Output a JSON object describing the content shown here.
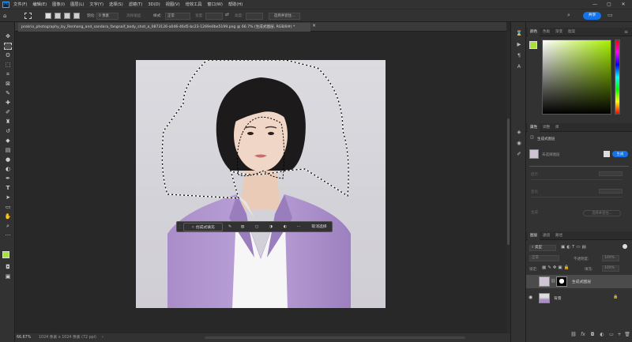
{
  "app": {
    "logo": "Ps"
  },
  "menu": [
    "文件(F)",
    "编辑(E)",
    "图像(I)",
    "图层(L)",
    "文字(Y)",
    "选择(S)",
    "滤镜(T)",
    "3D(D)",
    "视图(V)",
    "增效工具",
    "窗口(W)",
    "帮助(H)"
  ],
  "window_controls": {
    "minimize": "—",
    "maximize": "▢",
    "close": "✕"
  },
  "options": {
    "feather_label": "羽化:",
    "feather_value": "0 像素",
    "antialias_label": "消除锯齿",
    "style_label": "样式:",
    "style_value": "正常",
    "width_label": "宽度:",
    "height_label": "高度:",
    "select_mask_label": "选择并遮住...",
    "share_label": "共享"
  },
  "document": {
    "tab_title": "prokrio_photography_by_Renhang_and_sandara_fangnaif_body_shot_a_0873126-a046-46d5-bc23-1269e0be5199.png @ 66.7% (生成式图层, RGB/8#) *",
    "close_label": "×"
  },
  "context_bar": {
    "generative_fill_label": "创成式填充",
    "deselect_label": "取消选择",
    "more_label": "···"
  },
  "status": {
    "zoom": "66.67%",
    "doc_info": "1024 像素 x 1024 像素 (72 ppi)",
    "arrow": "›"
  },
  "color_panel": {
    "tabs": [
      "颜色",
      "色板",
      "渐变",
      "图案"
    ],
    "hue_color": "#a8f000",
    "foreground_color": "#a8e03c",
    "background_color": "#ffffff"
  },
  "properties_panel": {
    "tabs": [
      "属性",
      "调整",
      "库"
    ],
    "layer_kind": "生成式图层",
    "layer_name": "未选择图层",
    "generate_button": "生成",
    "field1_label": "提示",
    "field2_label": "变化",
    "field3_label": "生成",
    "select_button": "选择并遮住..."
  },
  "layers_panel": {
    "tabs": [
      "图层",
      "通道",
      "路径"
    ],
    "filter_kind": "类型",
    "blend_mode": "正常",
    "opacity_label": "不透明度:",
    "opacity_value": "100%",
    "lock_label": "锁定:",
    "fill_label": "填充:",
    "fill_value": "100%",
    "layers": [
      {
        "name": "生成式图层",
        "visible": false,
        "selected": true
      },
      {
        "name": "背景",
        "visible": true,
        "selected": false,
        "locked": true
      }
    ]
  }
}
